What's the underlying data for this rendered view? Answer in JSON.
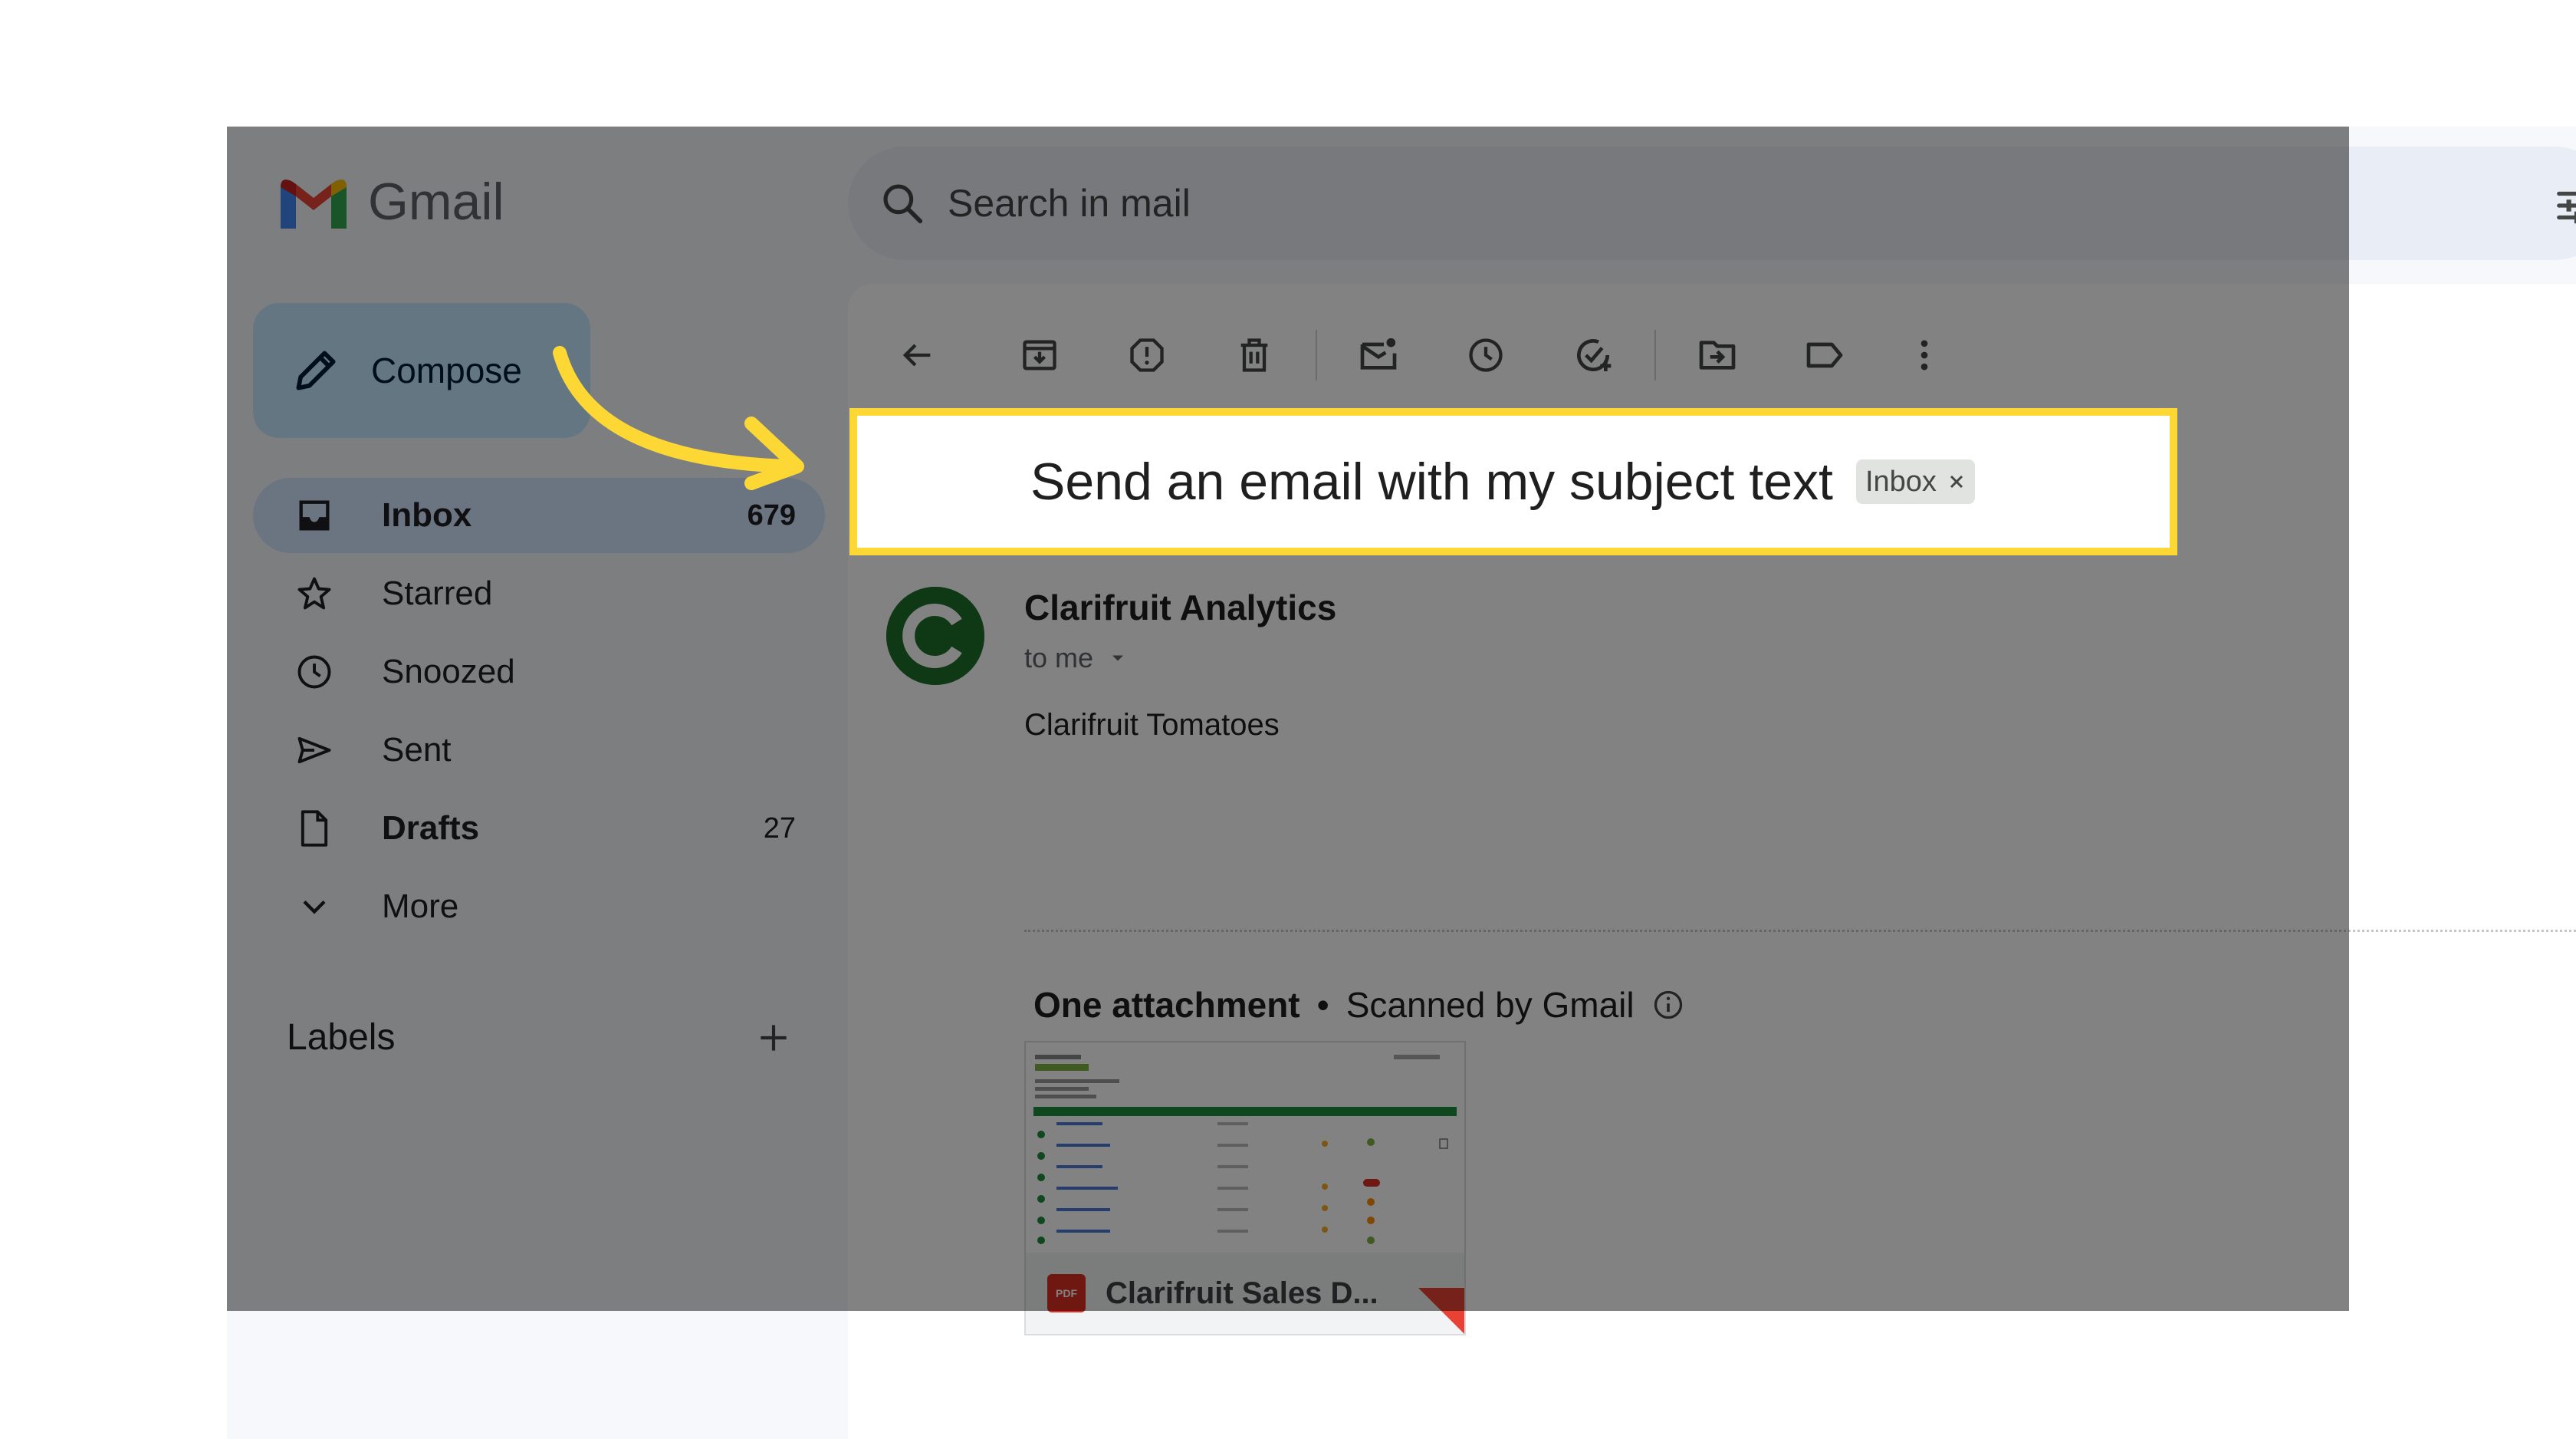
{
  "app": {
    "name": "Gmail"
  },
  "search": {
    "placeholder": "Search in mail"
  },
  "compose": {
    "label": "Compose"
  },
  "nav": [
    {
      "label": "Inbox",
      "count": "679",
      "icon": "inbox-icon",
      "active": true
    },
    {
      "label": "Starred",
      "count": "",
      "icon": "star-icon"
    },
    {
      "label": "Snoozed",
      "count": "",
      "icon": "clock-icon"
    },
    {
      "label": "Sent",
      "count": "",
      "icon": "send-icon"
    },
    {
      "label": "Drafts",
      "count": "27",
      "icon": "draft-icon"
    },
    {
      "label": "More",
      "count": "",
      "icon": "chevron-down-icon"
    }
  ],
  "labels": {
    "title": "Labels"
  },
  "toolbar": [
    "back-arrow-icon",
    "archive-icon",
    "report-spam-icon",
    "delete-icon",
    "mark-unread-icon",
    "snooze-icon",
    "add-task-icon",
    "move-to-icon",
    "label-icon",
    "more-vert-icon"
  ],
  "email": {
    "subject": "Send an email with my subject text",
    "label_chip": "Inbox",
    "sender": "Clarifruit Analytics",
    "recipient_line": "to me",
    "body": "Clarifruit Tomatoes",
    "attachment_header": "One attachment",
    "scan_note": "Scanned by Gmail",
    "attachment_name": "Clarifruit Sales D...",
    "attachment_type": "PDF"
  },
  "colors": {
    "highlight": "#fdd835",
    "avatar": "#1f6f2a",
    "compose_bg": "#c2e7ff",
    "active_nav": "#d3e3fd"
  }
}
